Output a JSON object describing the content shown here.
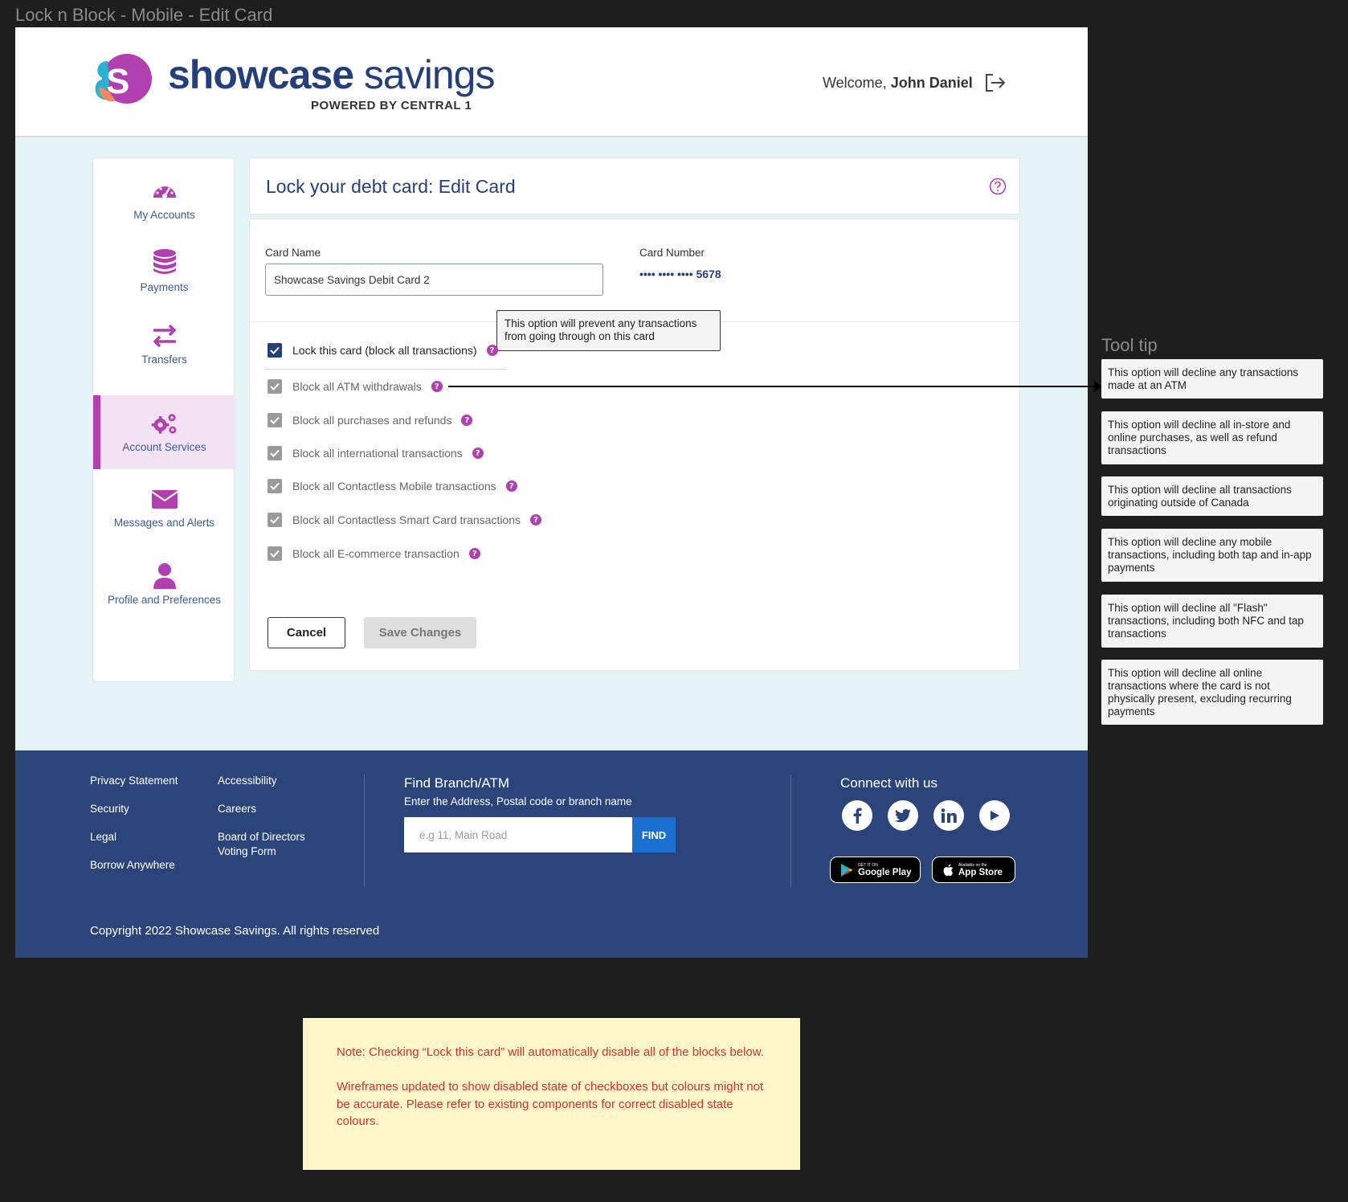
{
  "frame_title": "Lock n Block - Mobile - Edit Card",
  "header": {
    "brand_bold": "showcase",
    "brand_light": "savings",
    "brand_sub": "POWERED BY CENTRAL 1",
    "welcome_prefix": "Welcome, ",
    "user_name": "John Daniel"
  },
  "sidebar": {
    "items": [
      {
        "label": "My Accounts",
        "icon": "dashboard-gauge-icon"
      },
      {
        "label": "Payments",
        "icon": "coins-icon"
      },
      {
        "label": "Transfers",
        "icon": "arrows-transfer-icon"
      },
      {
        "label": "Account Services",
        "icon": "gears-icon",
        "active": true
      },
      {
        "label": "Messages and Alerts",
        "icon": "envelope-icon"
      },
      {
        "label": "Profile and Preferences",
        "icon": "user-icon"
      }
    ]
  },
  "page": {
    "title": "Lock your debt card: Edit Card"
  },
  "form": {
    "card_name_label": "Card Name",
    "card_name_value": "Showcase Savings Debit Card 2",
    "card_number_label": "Card Number",
    "card_number_value": "•••• •••• •••• 5678",
    "inline_tooltip": "This option will prevent any transactions from going through on this card",
    "lock_label": "Lock this card (block all transactions)",
    "options": [
      "Block all ATM withdrawals",
      "Block all purchases and refunds",
      "Block all international transactions",
      "Block all Contactless Mobile transactions",
      "Block all Contactless Smart Card transactions",
      "Block all E-commerce transaction"
    ],
    "cancel_label": "Cancel",
    "save_label": "Save Changes"
  },
  "footer": {
    "links_col1": [
      "Privacy Statement",
      "Security",
      "Legal",
      "Borrow Anywhere"
    ],
    "links_col2": [
      "Accessibility",
      "Careers",
      "Board of Directors Voting Form"
    ],
    "find_title": "Find Branch/ATM",
    "find_sub": "Enter the Address, Postal code or branch name",
    "find_placeholder": "e.g 11, Main Road",
    "find_button": "FIND",
    "connect_title": "Connect with us",
    "google_small": "GET IT ON",
    "google_big": "Google Play",
    "apple_small": "Available on the",
    "apple_big": "App Store",
    "copyright": "Copyright 2022 Showcase Savings. All rights reserved"
  },
  "tooltips": {
    "heading": "Tool tip",
    "items": [
      "This option will decline any transactions made at an ATM",
      "This option will decline all in-store and online purchases, as well as refund transactions",
      "This option will decline all transactions originating outside of Canada",
      "This option will decline any mobile transactions, including both tap and in-app payments",
      "This option will decline all \"Flash\" transactions, including both NFC and tap transactions",
      "This option will decline all online transactions where the card is not physically present, excluding recurring payments"
    ]
  },
  "note": {
    "line1": "Note: Checking “Lock this card” will automatically disable all of the blocks below.",
    "line2": "Wireframes updated to show disabled state of checkboxes but colours might not be accurate. Please refer to existing components for correct disabled state colours."
  },
  "colors": {
    "brand_navy": "#243f7c",
    "brand_purple": "#b03fb0",
    "footer_bg": "#2b4479",
    "page_bg": "#e4f3f6",
    "note_bg": "#fef6c8",
    "note_text": "#d2322c"
  }
}
